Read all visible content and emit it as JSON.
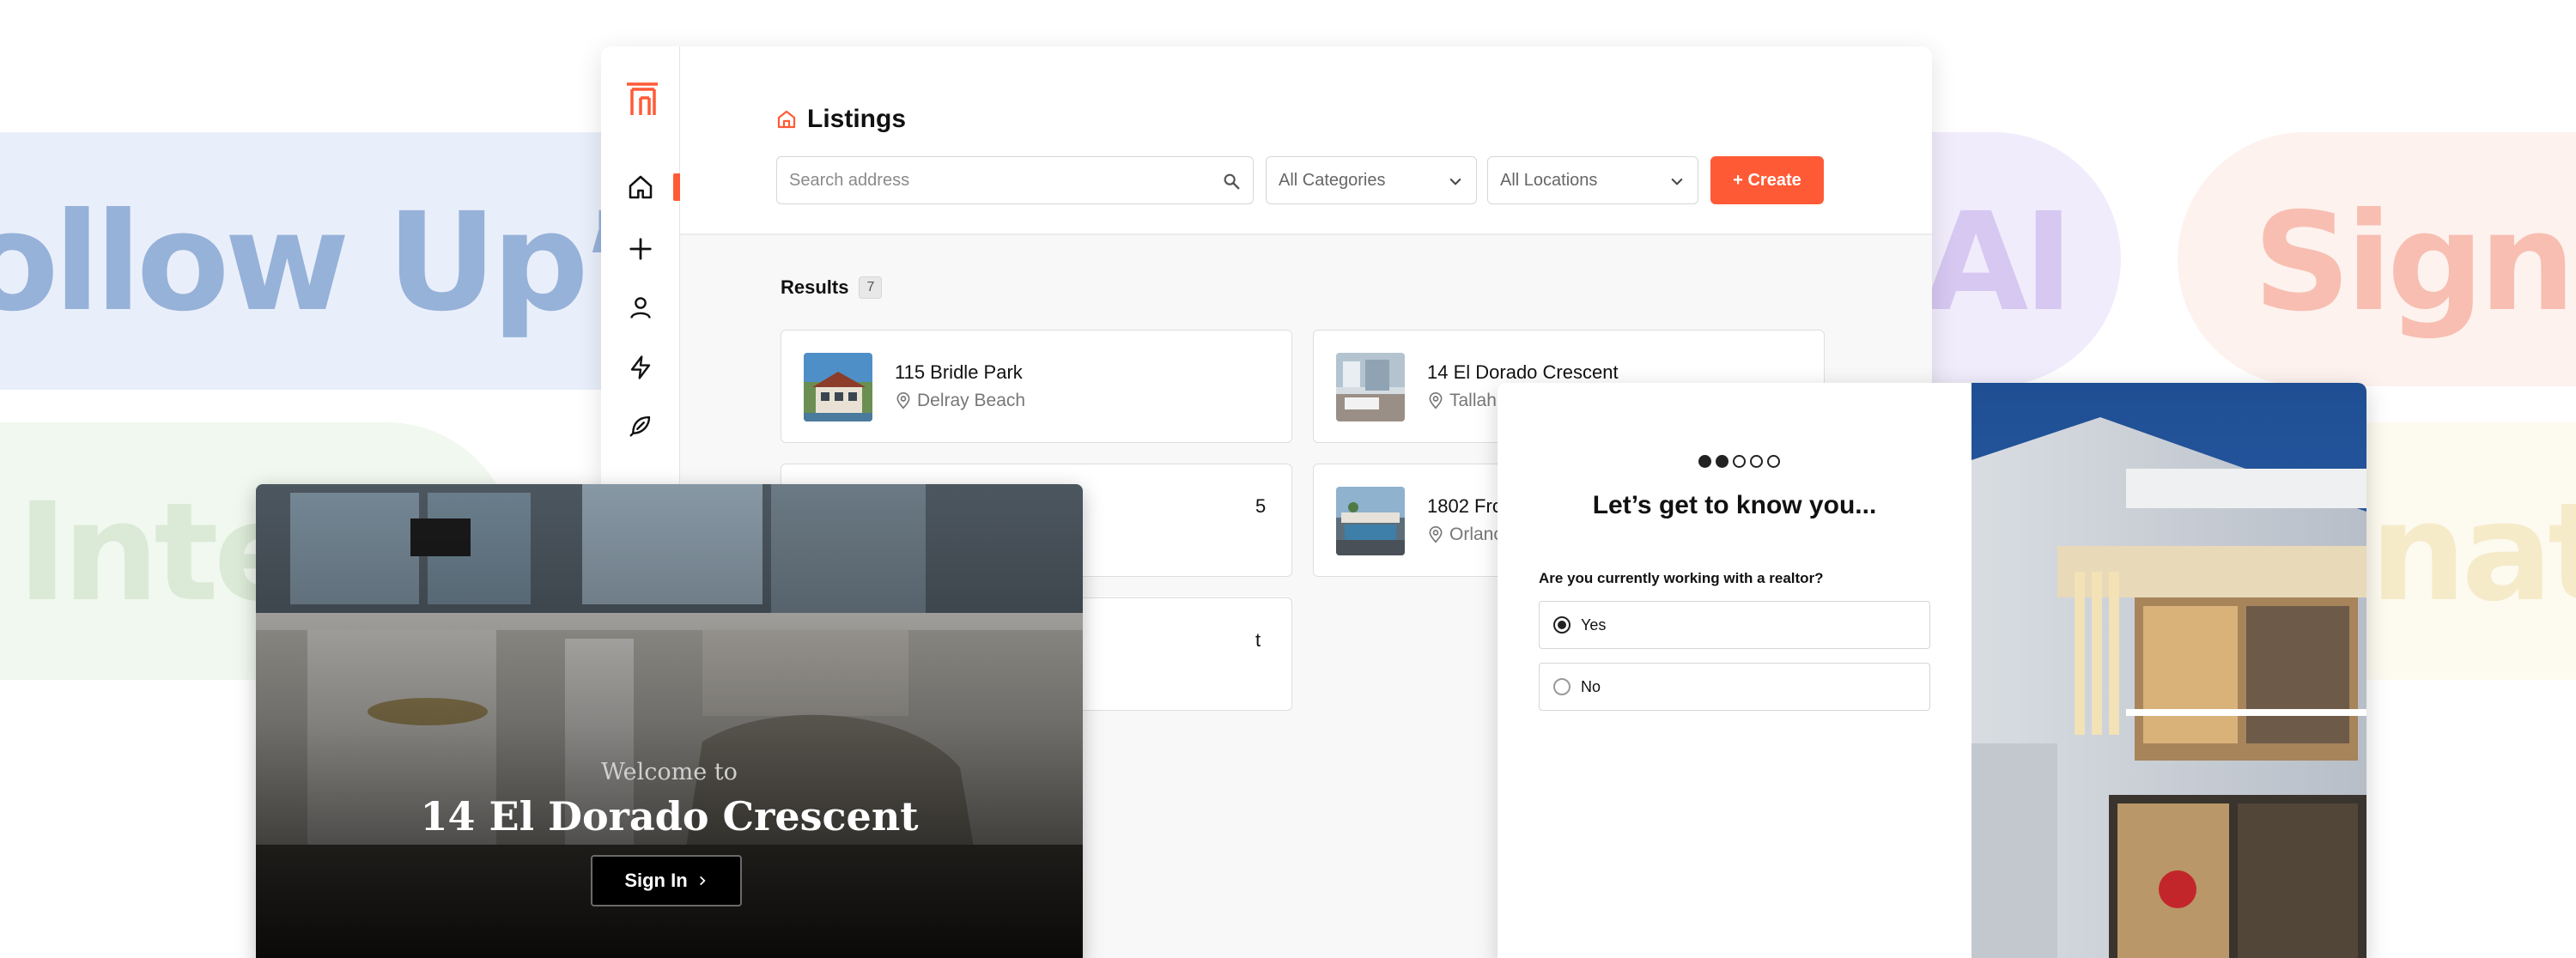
{
  "background": {
    "follow": "ollow Up’s",
    "ai": "AI",
    "sign": "Sign I",
    "inte": "Inte",
    "nati": "nati"
  },
  "colors": {
    "accent": "#ff5a36"
  },
  "sidebar": {
    "logo": "brand-logo",
    "items": [
      {
        "icon": "home-icon",
        "active": true
      },
      {
        "icon": "plus-icon"
      },
      {
        "icon": "user-icon"
      },
      {
        "icon": "lightning-icon"
      },
      {
        "icon": "feather-icon"
      }
    ]
  },
  "listings": {
    "title": "Listings",
    "search_placeholder": "Search address",
    "category_select": "All Categories",
    "location_select": "All Locations",
    "create_label": "+ Create",
    "results_label": "Results",
    "results_count": "7",
    "cards": [
      {
        "name": "115 Bridle Park",
        "location": "Delray Beach"
      },
      {
        "name": "14 El Dorado Crescent",
        "location": "Tallah"
      },
      {
        "name": "5",
        "location": ""
      },
      {
        "name": "1802 Fro",
        "location": "Orlanc"
      },
      {
        "name": "t",
        "location": ""
      }
    ]
  },
  "welcome": {
    "subtitle": "Welcome to",
    "title": "14 El Dorado Crescent",
    "signin_label": "Sign In"
  },
  "quiz": {
    "progress": {
      "current": 2,
      "total": 5
    },
    "title": "Let’s get to know you...",
    "question": "Are you currently working with a realtor?",
    "options": [
      {
        "label": "Yes",
        "selected": true
      },
      {
        "label": "No",
        "selected": false
      }
    ]
  }
}
